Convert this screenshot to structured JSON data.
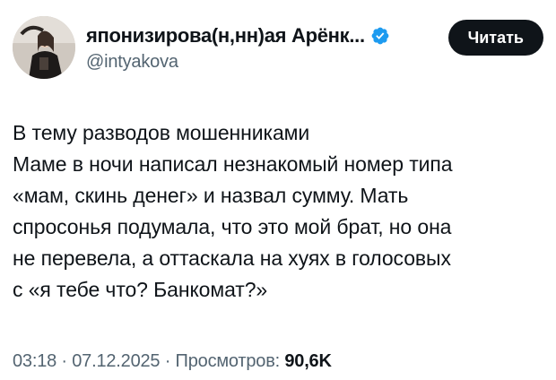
{
  "author": {
    "display_name": "японизирова(н,нн)ая Арёнк...",
    "handle": "@intyakova",
    "verified": true,
    "avatar": "profile-photo"
  },
  "follow_button_label": "Читать",
  "tweet": {
    "lines": [
      "В тему разводов мошенниками",
      "Маме в ночи написал незнакомый номер типа",
      "«мам, скинь денег» и назвал сумму. Мать",
      "спросонья подумала, что это мой брат, но она",
      "не перевела, а оттаскала на хуях в голосовых",
      "с «я тебе что? Банкомат?»"
    ]
  },
  "meta": {
    "time": "03:18",
    "separator": " · ",
    "date": "07.12.2025",
    "views_label": "Просмотров:",
    "views_count": "90,6K"
  },
  "colors": {
    "text": "#0f1419",
    "secondary": "#536471",
    "verified": "#1d9bf0",
    "button_bg": "#0f1419",
    "button_text": "#ffffff"
  }
}
